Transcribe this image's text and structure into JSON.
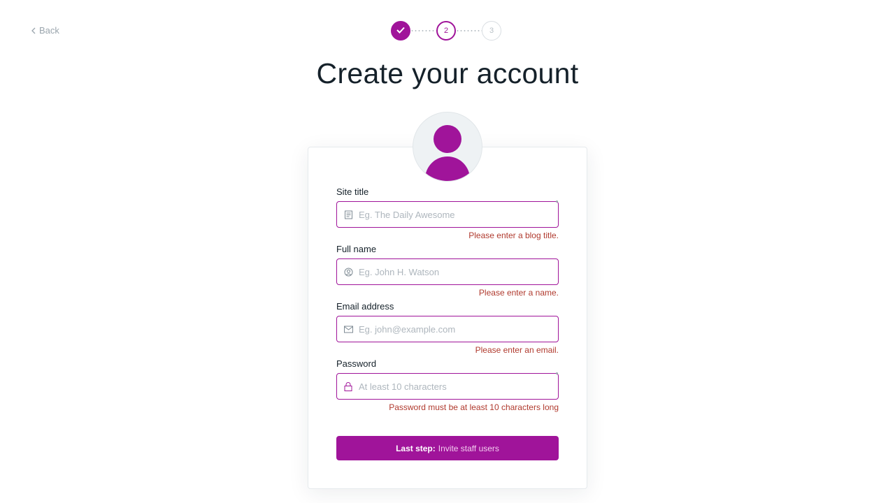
{
  "nav": {
    "back_label": "Back"
  },
  "steps": [
    {
      "label": "",
      "state": "done"
    },
    {
      "label": "2",
      "state": "active"
    },
    {
      "label": "3",
      "state": "todo"
    }
  ],
  "page_title": "Create your account",
  "form": {
    "site_title": {
      "label": "Site title",
      "placeholder": "Eg. The Daily Awesome",
      "error": "Please enter a blog title."
    },
    "full_name": {
      "label": "Full name",
      "placeholder": "Eg. John H. Watson",
      "error": "Please enter a name."
    },
    "email": {
      "label": "Email address",
      "placeholder": "Eg. john@example.com",
      "error": "Please enter an email."
    },
    "password": {
      "label": "Password",
      "placeholder": "At least 10 characters",
      "error": "Password must be at least 10 characters long"
    }
  },
  "submit": {
    "label_strong": "Last step:",
    "label_weak": "Invite staff users"
  },
  "colors": {
    "accent": "#a0149a",
    "error": "#b03a2e"
  }
}
